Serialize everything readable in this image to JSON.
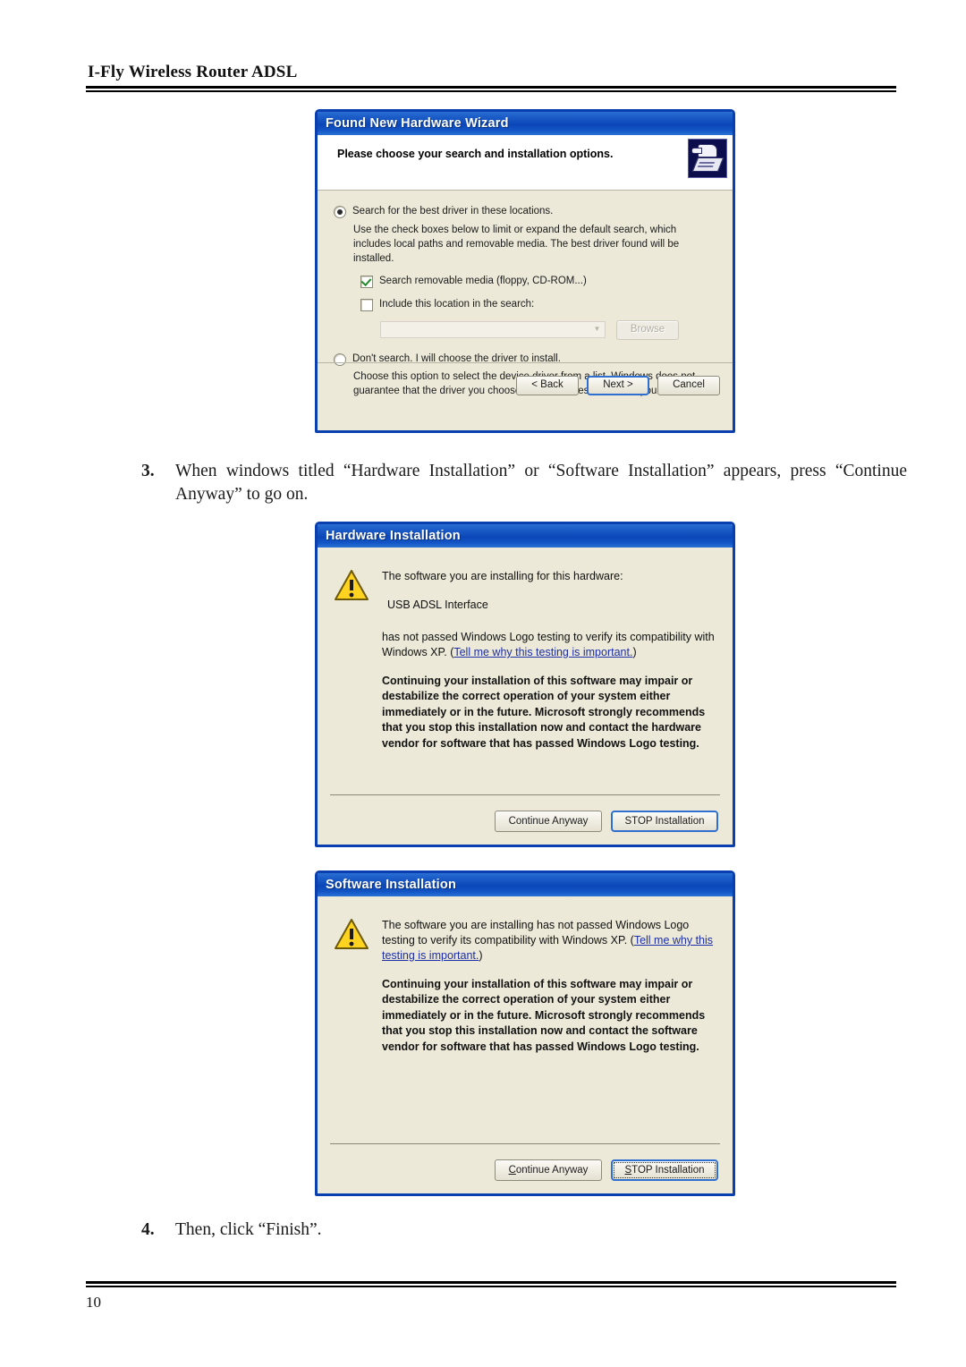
{
  "document": {
    "header_title": "I-Fly Wireless Router ADSL",
    "page_number": "10"
  },
  "steps": [
    {
      "number": "3.",
      "text": "When windows titled “Hardware Installation” or “Software Installation” appears, press “Continue Anyway” to go on."
    },
    {
      "number": "4.",
      "text": "Then, click “Finish”."
    }
  ],
  "wizard": {
    "title": "Found New Hardware Wizard",
    "heading": "Please choose your search and installation options.",
    "icon": "driver-wizard-icon",
    "option_search": {
      "label": "Search for the best driver in these locations.",
      "selected": true,
      "description": "Use the check boxes below to limit or expand the default search, which includes local paths and removable media. The best driver found will be installed."
    },
    "checkbox_removable": {
      "label": "Search removable media (floppy, CD-ROM...)",
      "checked": true
    },
    "checkbox_location": {
      "label": "Include this location in the search:",
      "checked": false
    },
    "location_combo": {
      "value": "",
      "disabled": true
    },
    "browse_button": {
      "label": "Browse",
      "disabled": true
    },
    "option_dont_search": {
      "label": "Don't search. I will choose the driver to install.",
      "selected": false,
      "description": "Choose this option to select the device driver from a list.  Windows does not guarantee that the driver you choose will be the best match for your hardware."
    },
    "buttons": {
      "back": "< Back",
      "next": "Next >",
      "cancel": "Cancel"
    }
  },
  "hardware_dialog": {
    "title": "Hardware Installation",
    "icon": "warning-triangle-icon",
    "line1": "The software you are installing for this hardware:",
    "device": "USB ADSL Interface",
    "line2_before_link": "has not passed Windows Logo testing to verify its compatibility with Windows XP. (",
    "link": "Tell me why this testing is important.",
    "line2_after_link": ")",
    "warning": "Continuing your installation of this software may impair or destabilize the correct operation of your system either immediately or in the future. Microsoft strongly recommends that you stop this installation now and contact the hardware vendor for software that has passed Windows Logo testing.",
    "buttons": {
      "continue": "Continue Anyway",
      "stop": "STOP Installation"
    }
  },
  "software_dialog": {
    "title": "Software Installation",
    "icon": "warning-triangle-icon",
    "line1_before_link": "The software you are installing has not passed Windows Logo testing to verify its compatibility with Windows XP. (",
    "link": "Tell me why this testing is important.",
    "line1_after_link": ")",
    "warning": "Continuing your installation of this software may impair or destabilize the correct operation of your system either immediately or in the future. Microsoft strongly recommends that you stop this installation now and contact the software vendor for software that has passed Windows Logo testing.",
    "buttons": {
      "continue_prefix": "C",
      "continue": "ontinue Anyway",
      "stop_prefix": "S",
      "stop": "TOP Installation"
    }
  },
  "colors": {
    "titlebar_blue": "#0b46b8",
    "dialog_border": "#0a3fb0",
    "dialog_face": "#ece9d8",
    "link_blue": "#1c2ea8",
    "warning_yellow": "#ffd320"
  }
}
